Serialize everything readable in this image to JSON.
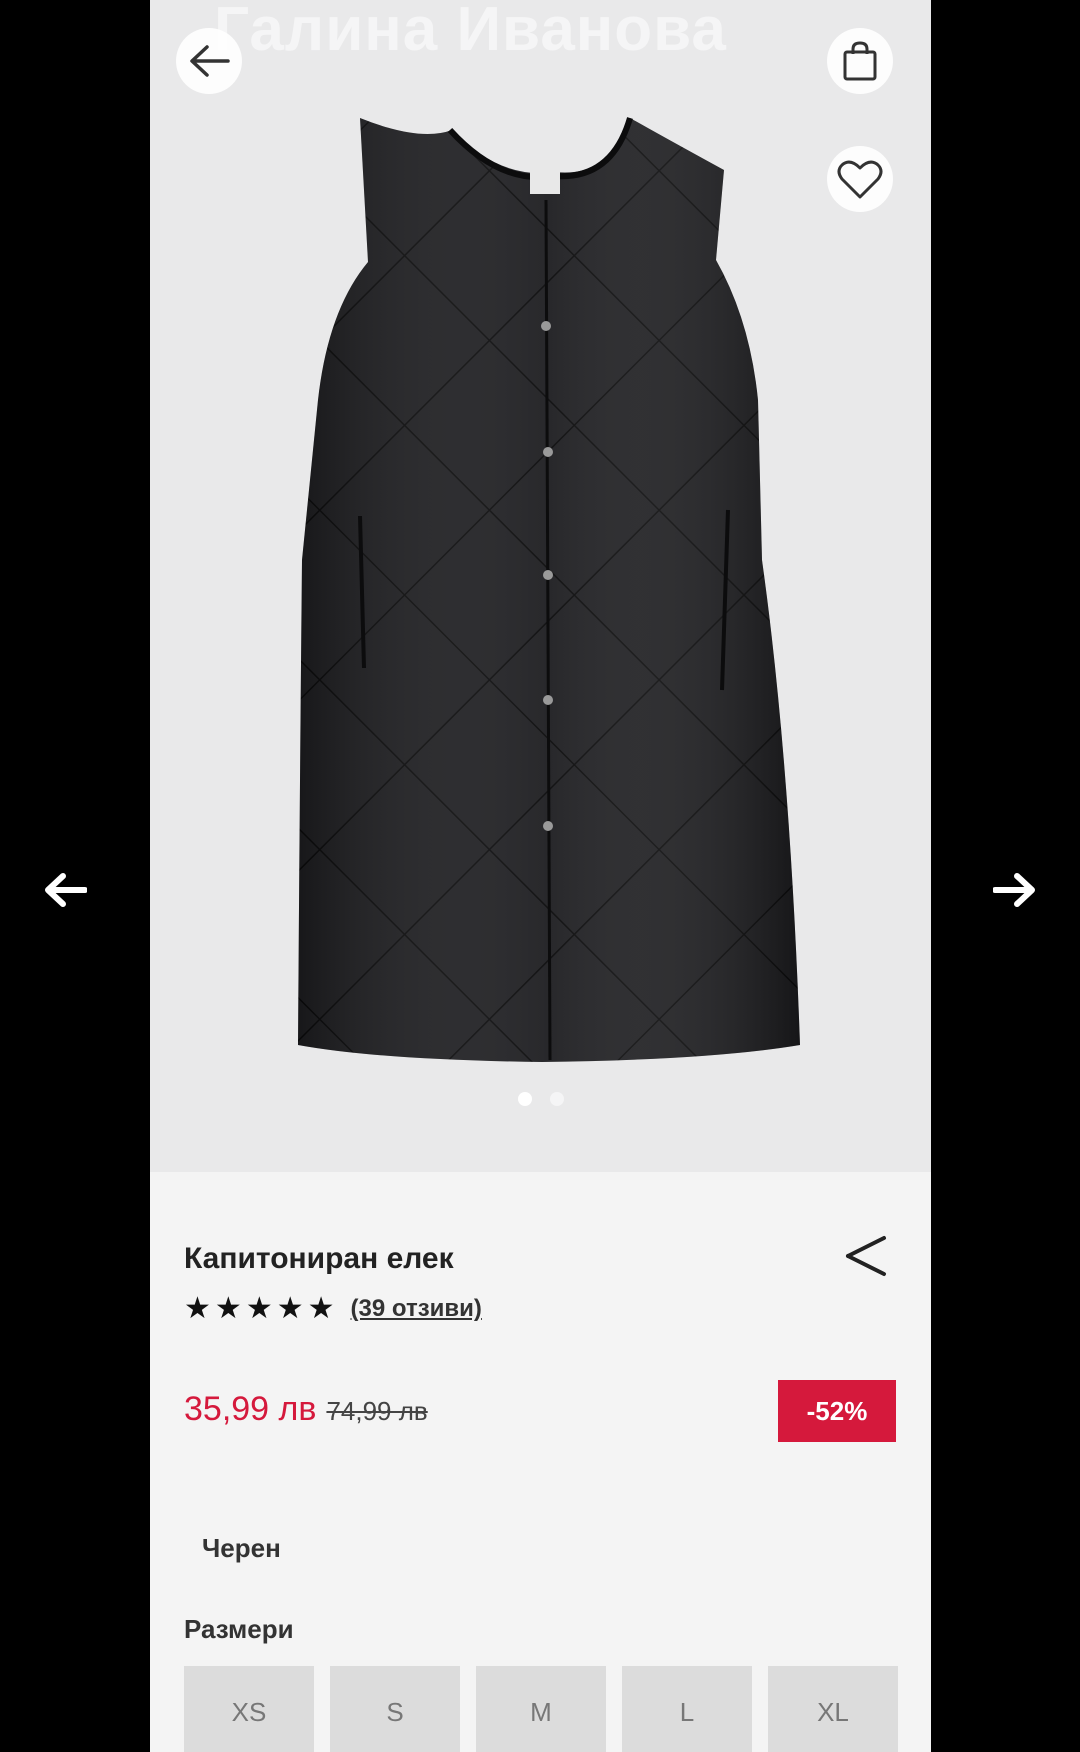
{
  "viewer": {
    "prev_icon": "arrow-left-icon",
    "next_icon": "arrow-right-icon"
  },
  "header": {
    "seller_name": "Галина Иванова",
    "back_icon": "arrow-left-icon",
    "bag_icon": "shopping-bag-icon",
    "favorite_icon": "heart-icon"
  },
  "gallery": {
    "image_count": 2,
    "active_index": 0
  },
  "product": {
    "title": "Капитониран елек",
    "rating_stars": 5,
    "reviews_label": "(39 отзиви)",
    "price": "35,99 лв",
    "old_price": "74,99 лв",
    "discount_label": "-52%",
    "color": "Черен",
    "sizes_label": "Размери",
    "sizes": [
      "XS",
      "S",
      "M",
      "L",
      "XL"
    ]
  },
  "colors": {
    "accent": "#d5193c",
    "panel_bg": "#f4f4f4",
    "hero_bg": "#e9e9ea"
  }
}
